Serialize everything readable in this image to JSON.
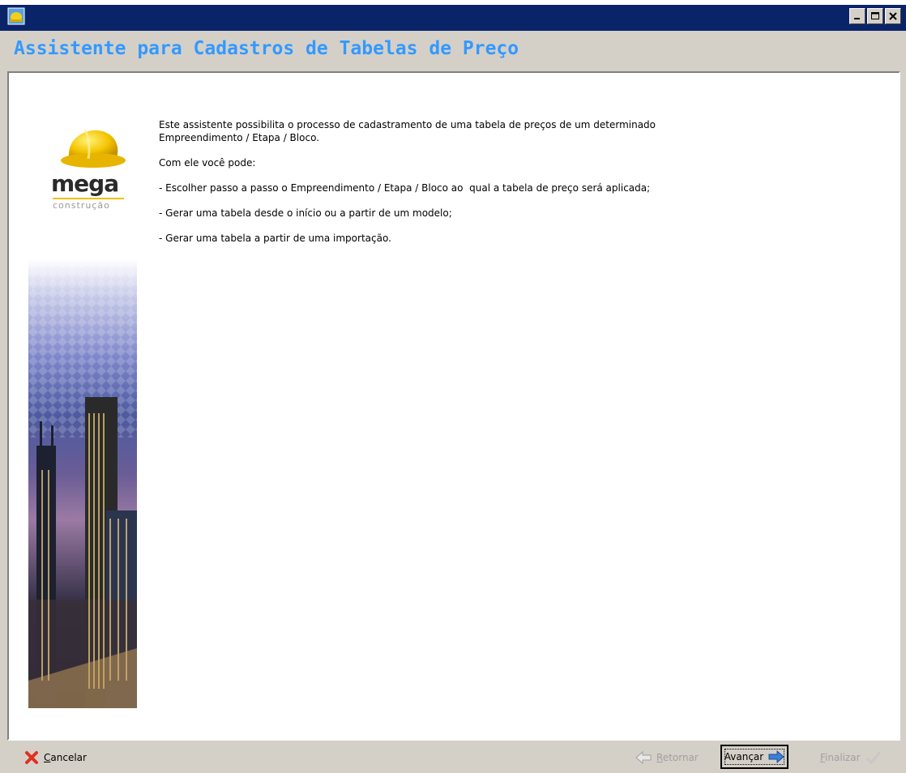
{
  "window": {
    "title": "",
    "controls": [
      "minimize-icon",
      "maximize-icon",
      "close-icon"
    ]
  },
  "wizard": {
    "title": "Assistente para Cadastros de Tabelas de Preço",
    "title_color": "#3399ff"
  },
  "logo": {
    "brand": "mega",
    "subtitle": "construção"
  },
  "content": {
    "paragraphs": [
      "Este assistente possibilita o processo de cadastramento de uma tabela de preços de um determinado\nEmpreendimento / Etapa / Bloco.",
      "Com ele você pode:",
      "- Escolher passo a passo o Empreendimento / Etapa / Bloco ao  qual a tabela de preço será aplicada;",
      "- Gerar uma tabela desde o início ou a partir de um modelo;",
      "- Gerar uma tabela a partir de uma importação."
    ]
  },
  "footer": {
    "cancel_label": "Cancelar",
    "back_label": "Retornar",
    "next_label": "Avançar",
    "finish_label": "Finalizar"
  },
  "colors": {
    "titlebar": "#0a246a",
    "chrome": "#d4d0c8",
    "accent_blue": "#3399ff",
    "cancel_red": "#e03020",
    "disabled_text": "#a0a0a0"
  }
}
